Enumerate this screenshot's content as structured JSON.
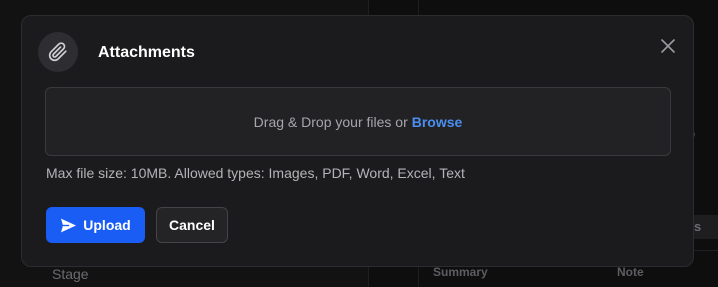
{
  "dialog": {
    "title": "Attachments",
    "header_icon": "paperclip-icon",
    "close_icon": "close-icon"
  },
  "dropzone": {
    "text": "Drag & Drop your files or",
    "browse_label": "Browse"
  },
  "hint": "Max file size: 10MB. Allowed types: Images, PDF, Word, Excel, Text",
  "actions": {
    "upload_label": "Upload",
    "upload_icon": "send-icon",
    "cancel_label": "Cancel"
  },
  "background": {
    "stage_label": "Stage",
    "summary_header": "Summary",
    "note_header": "Note",
    "partial_text": "o",
    "partial_button": "ros"
  },
  "colors": {
    "accent": "#1a5df5",
    "link": "#4a8ff0",
    "modal_bg": "#1b1b1d"
  }
}
